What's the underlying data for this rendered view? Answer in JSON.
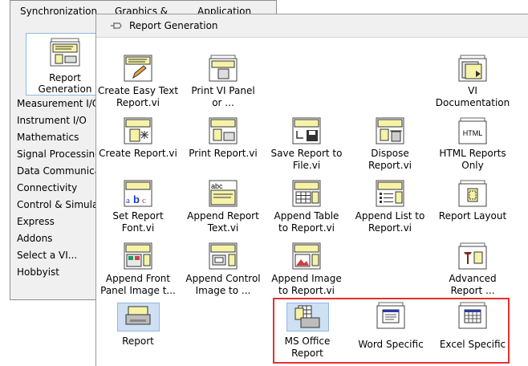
{
  "back_palette": {
    "top_labels": [
      "Synchronization",
      "Graphics &",
      "Application"
    ],
    "selected": {
      "label_line1": "Report",
      "label_line2": "Generation"
    },
    "categories": [
      "Measurement I/O",
      "Instrument I/O",
      "Mathematics",
      "Signal Processing",
      "Data Communicat",
      "Connectivity",
      "Control & Simulat",
      "Express",
      "Addons",
      "Select a VI...",
      "Hobbyist"
    ]
  },
  "front_palette": {
    "title": "Report Generation",
    "items": [
      {
        "l1": "Create Easy Text",
        "l2": "Report.vi"
      },
      {
        "l1": "Print VI Panel",
        "l2": "or ..."
      },
      {
        "l1": "VI",
        "l2": "Documentation"
      },
      {
        "l1": "Create Report.vi",
        "l2": ""
      },
      {
        "l1": "Print Report.vi",
        "l2": ""
      },
      {
        "l1": "Save Report to",
        "l2": "File.vi"
      },
      {
        "l1": "Dispose",
        "l2": "Report.vi"
      },
      {
        "l1": "HTML Reports",
        "l2": "Only"
      },
      {
        "l1": "Set Report",
        "l2": "Font.vi"
      },
      {
        "l1": "Append Report",
        "l2": "Text.vi"
      },
      {
        "l1": "Append Table",
        "l2": "to Report.vi"
      },
      {
        "l1": "Append List to",
        "l2": "Report.vi"
      },
      {
        "l1": "Report Layout",
        "l2": ""
      },
      {
        "l1": "Append Front",
        "l2": "Panel Image t..."
      },
      {
        "l1": "Append Control",
        "l2": "Image to ..."
      },
      {
        "l1": "Append Image",
        "l2": "to Report.vi"
      },
      {
        "l1": "Advanced",
        "l2": "Report ..."
      },
      {
        "l1": "Report",
        "l2": ""
      },
      {
        "l1": "MS Office",
        "l2": "Report"
      },
      {
        "l1": "Word Specific",
        "l2": ""
      },
      {
        "l1": "Excel Specific",
        "l2": ""
      }
    ],
    "html_icon_text": "HTML",
    "abc_icon_text": "abc"
  }
}
